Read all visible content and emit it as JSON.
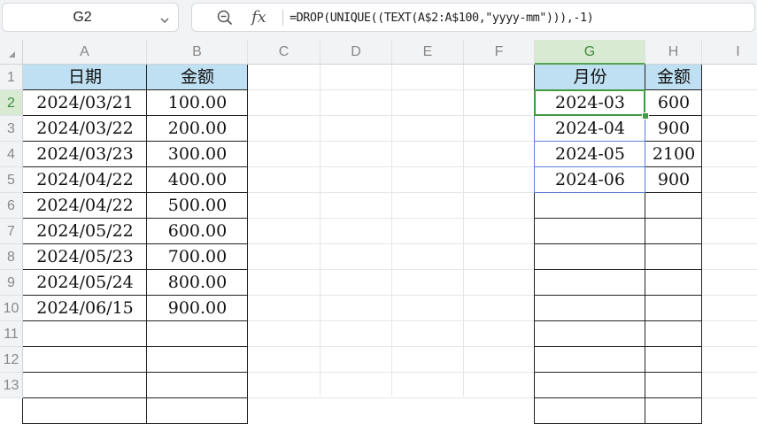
{
  "name_box": {
    "value": "G2"
  },
  "formula_bar": {
    "zoom_icon": "zoom-icon",
    "fx_label": "fx",
    "formula": "=DROP(UNIQUE((TEXT(A$2:A$100,\"yyyy-mm\"))),-1)"
  },
  "columns": [
    "A",
    "B",
    "C",
    "D",
    "E",
    "F",
    "G",
    "H",
    "I"
  ],
  "rows": [
    "1",
    "2",
    "3",
    "4",
    "5",
    "6",
    "7",
    "8",
    "9",
    "10",
    "11",
    "12",
    "13"
  ],
  "table_left": {
    "headers": [
      "日期",
      "金额"
    ],
    "rows": [
      [
        "2024/03/21",
        "100.00"
      ],
      [
        "2024/03/22",
        "200.00"
      ],
      [
        "2024/03/23",
        "300.00"
      ],
      [
        "2024/04/22",
        "400.00"
      ],
      [
        "2024/04/22",
        "500.00"
      ],
      [
        "2024/05/22",
        "600.00"
      ],
      [
        "2024/05/23",
        "700.00"
      ],
      [
        "2024/05/24",
        "800.00"
      ],
      [
        "2024/06/15",
        "900.00"
      ]
    ]
  },
  "table_right": {
    "headers": [
      "月份",
      "金额"
    ],
    "rows": [
      [
        "2024-03",
        "600"
      ],
      [
        "2024-04",
        "900"
      ],
      [
        "2024-05",
        "2100"
      ],
      [
        "2024-06",
        "900"
      ]
    ]
  },
  "colors": {
    "header_fill": "#bfe0f2",
    "active_cell_border": "#3f9b3f",
    "spill_border": "#5b7fd6",
    "selected_header": "#d9ead3"
  }
}
